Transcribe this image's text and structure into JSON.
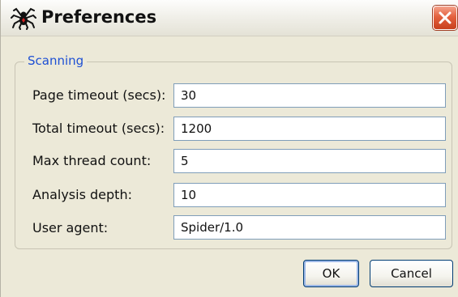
{
  "window": {
    "title": "Preferences",
    "app_icon": "spider-icon",
    "close_icon": "close-icon"
  },
  "scanning": {
    "legend": "Scanning",
    "fields": [
      {
        "label": "Page timeout (secs):",
        "value": "30"
      },
      {
        "label": "Total timeout (secs):",
        "value": "1200"
      },
      {
        "label": "Max thread count:",
        "value": "5"
      },
      {
        "label": "Analysis depth:",
        "value": "10"
      },
      {
        "label": "User agent:",
        "value": "Spider/1.0"
      }
    ]
  },
  "buttons": {
    "ok_label": "OK",
    "cancel_label": "Cancel"
  },
  "colors": {
    "dialog_background": "#ece9d8",
    "legend_text": "#1e50d4",
    "input_border": "#7f9db9",
    "close_button": "#e4613e",
    "default_button_highlight": "#9cb7e6"
  }
}
